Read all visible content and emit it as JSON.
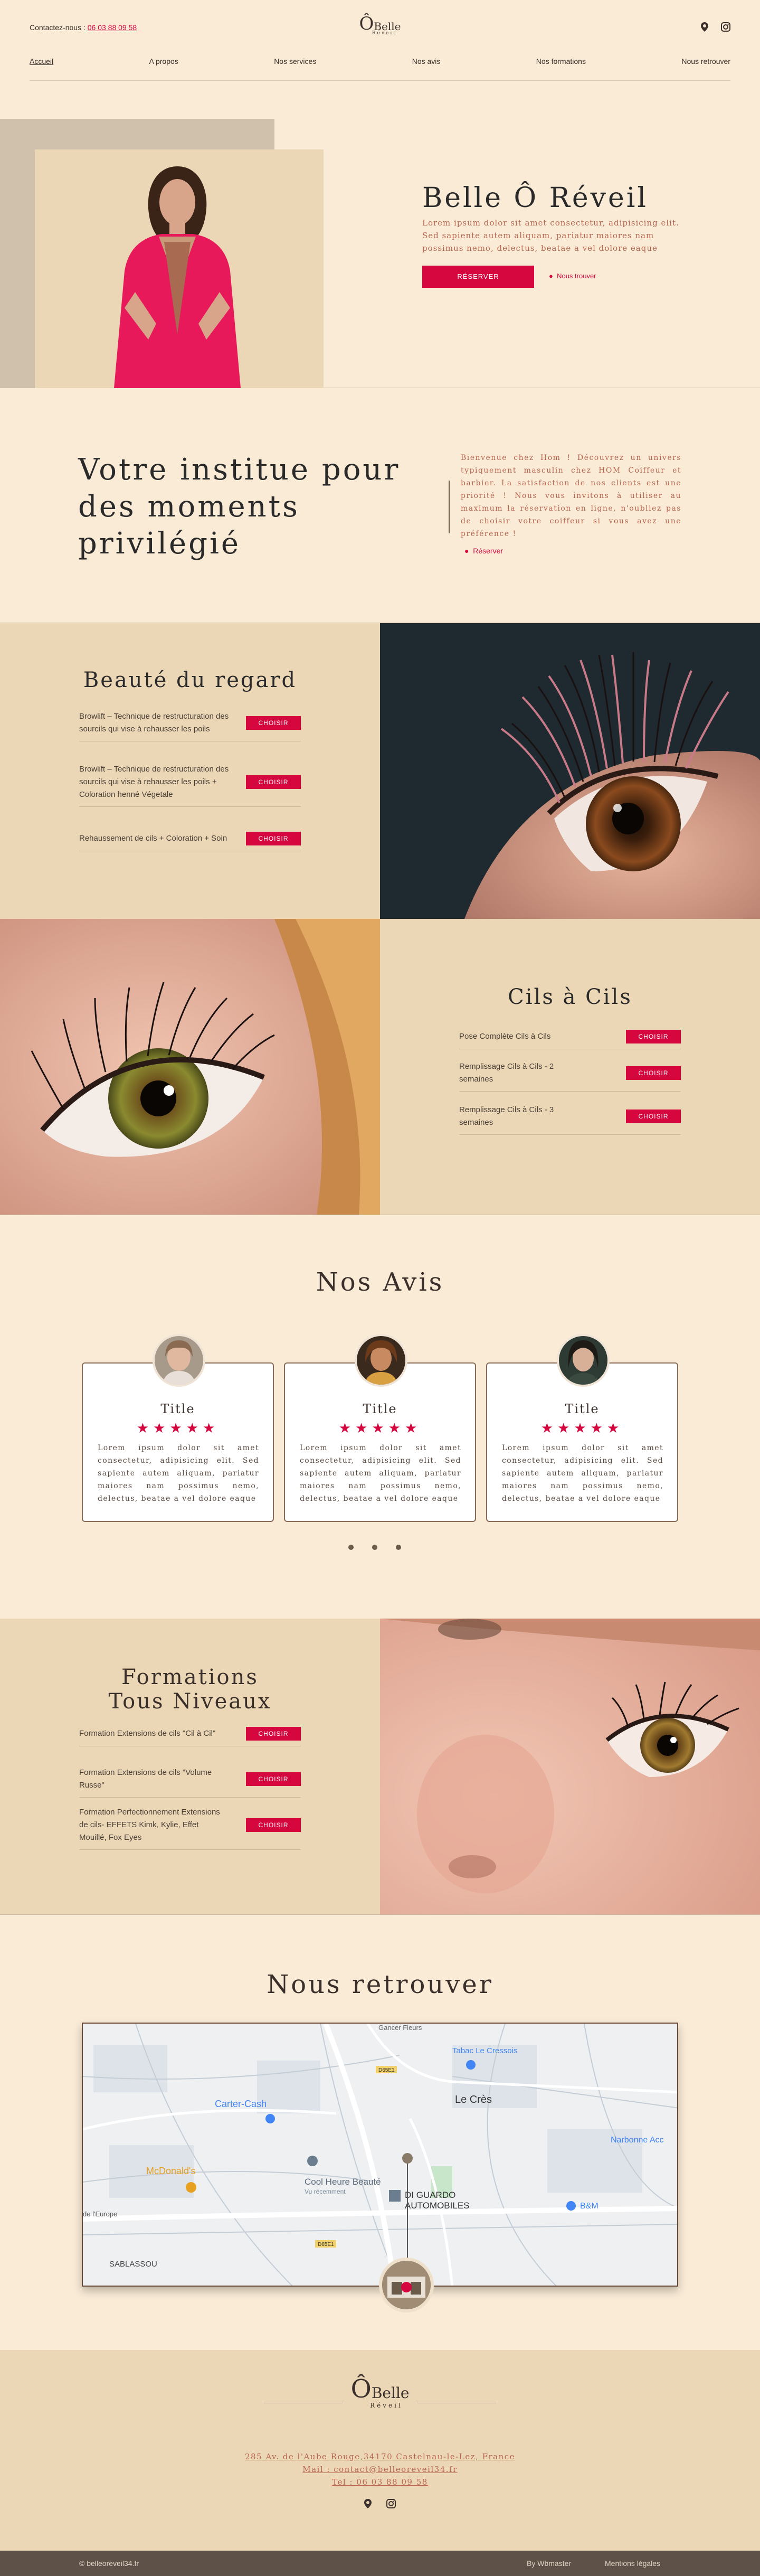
{
  "header": {
    "contact_label": "Contactez-nous :",
    "phone": "06 03 88 09 58",
    "logo": {
      "o": "Ô",
      "belle": "Belle",
      "reveil": "Réveil"
    },
    "icons": [
      "map-pin-icon",
      "instagram-icon"
    ]
  },
  "nav": [
    "Accueil",
    "A propos",
    "Nos services",
    "Nos avis",
    "Nos formations",
    "Nous retrouver"
  ],
  "hero": {
    "title": "Belle Ô Réveil",
    "text": "Lorem ipsum dolor sit amet consectetur, adipisicing elit. Sed sapiente autem aliquam, pariatur maiores nam possimus nemo, delectus, beatae a vel dolore eaque",
    "button": "RÉSERVER",
    "link": "Nous trouver"
  },
  "institut": {
    "title": "Votre institue pour des moments privilégié",
    "text": "Bienvenue chez Hom ! Découvrez un univers typiquement masculin chez HOM Coiffeur et barbier. La satisfaction de nos clients est une priorité ! Nous vous invitons à utiliser au maximum la réservation en ligne, n'oubliez pas de choisir votre coiffeur si vous avez une préférence !",
    "link": "Réserver"
  },
  "regard": {
    "title": "Beauté du regard",
    "items": [
      {
        "label": "Browlift – Technique de restructuration des sourcils qui vise à rehausser les poils",
        "button": "CHOISIR"
      },
      {
        "label": "Browlift – Technique de restructuration des sourcils qui vise à rehausser les poils + Coloration henné Végetale",
        "button": "CHOISIR"
      },
      {
        "label": "Rehaussement de cils + Coloration + Soin",
        "button": "CHOISIR"
      }
    ]
  },
  "cils": {
    "title": "Cils à Cils",
    "items": [
      {
        "label": "Pose Complète Cils à Cils",
        "button": "CHOISIR"
      },
      {
        "label": "Remplissage Cils à Cils - 2 semaines",
        "button": "CHOISIR"
      },
      {
        "label": "Remplissage Cils à Cils - 3 semaines",
        "button": "CHOISIR"
      }
    ]
  },
  "avis": {
    "title": "Nos Avis",
    "cards": [
      {
        "title": "Title",
        "stars": "★★★★★",
        "text": "Lorem ipsum dolor sit amet consectetur, adipisicing elit. Sed sapiente autem aliquam, pariatur maiores nam possimus nemo, delectus, beatae a vel dolore eaque"
      },
      {
        "title": "Title",
        "stars": "★★★★★",
        "text": "Lorem ipsum dolor sit amet consectetur, adipisicing elit. Sed sapiente autem aliquam, pariatur maiores nam possimus nemo, delectus, beatae a vel dolore eaque"
      },
      {
        "title": "Title",
        "stars": "★★★★★",
        "text": "Lorem ipsum dolor sit amet consectetur, adipisicing elit. Sed sapiente autem aliquam, pariatur maiores nam possimus nemo, delectus, beatae a vel dolore eaque"
      }
    ]
  },
  "formations": {
    "title_line1": "Formations",
    "title_line2": "Tous Niveaux",
    "items": [
      {
        "label": "Formation Extensions de cils \"Cil à Cil\"",
        "button": "CHOISIR"
      },
      {
        "label": "Formation Extensions de cils \"Volume Russe\"",
        "button": "CHOISIR"
      },
      {
        "label": "Formation Perfectionnement Extensions de cils- EFFETS Kimk, Kylie, Effet Mouillé, Fox Eyes",
        "button": "CHOISIR"
      }
    ]
  },
  "retrouver": {
    "title": "Nous retrouver",
    "map_labels": {
      "tabac": "Tabac Le Cressois",
      "lecres": "Le Crès",
      "carter": "Carter-Cash",
      "mcdo": "McDonald's",
      "cool": "Cool Heure Beauté",
      "cool_sub": "Vu récemment",
      "guardo1": "DI GUARDO",
      "guardo2": "AUTOMOBILES",
      "narbonne": "Narbonne Acc",
      "bm": "B&M",
      "sablassou": "SABLASSOU",
      "europe": "de l'Europe",
      "road1": "D65E1",
      "road2": "D65E1",
      "gancer": "Gancer Fleurs"
    }
  },
  "footer": {
    "address": "285 Av. de l'Aube Rouge,34170 Castelnau-le-Lez, France",
    "mail": "Mail : contact@belleoreveil34.fr",
    "tel": "Tel : 06 03 88 09 58",
    "copyright": "© belleoreveil34.fr",
    "by": "By Wbmaster",
    "legal": "Mentions légales"
  }
}
